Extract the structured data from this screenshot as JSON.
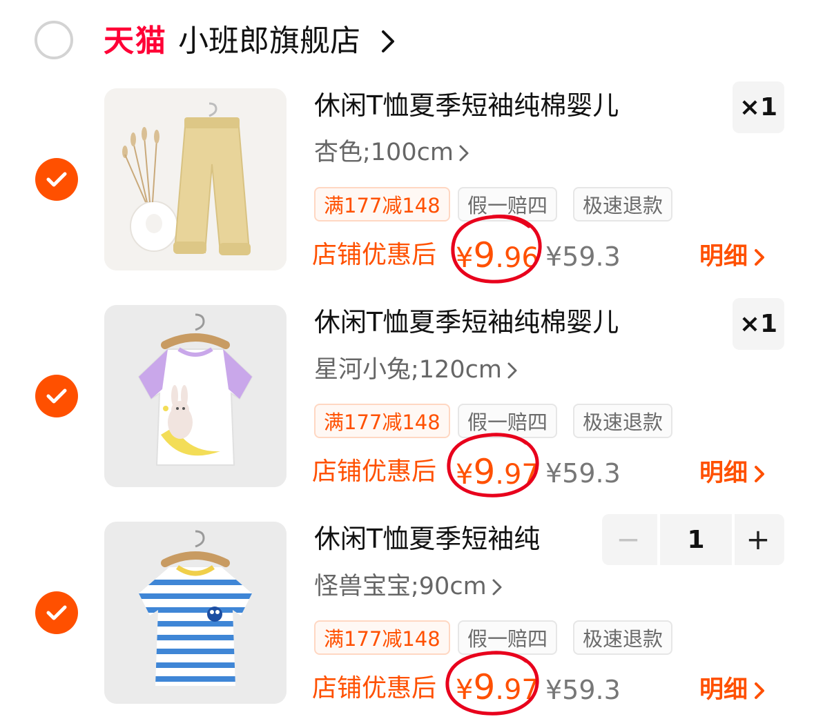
{
  "store": {
    "platform_logo": "天猫",
    "name": "小班郎旗舰店"
  },
  "items": [
    {
      "title": "休闲T恤夏季短袖纯棉婴儿",
      "sku": "杏色;100cm",
      "tags": [
        "满177减148",
        "假一赔四",
        "极速退款"
      ],
      "price_label": "店铺优惠后",
      "price_currency": "¥",
      "price_int": "9",
      "price_dec": ".96",
      "original_price": "¥59.3",
      "detail_label": "明细",
      "quantity": "×1",
      "image": "pants-icon"
    },
    {
      "title": "休闲T恤夏季短袖纯棉婴儿",
      "sku": "星河小兔;120cm",
      "tags": [
        "满177减148",
        "假一赔四",
        "极速退款"
      ],
      "price_label": "店铺优惠后",
      "price_currency": "¥",
      "price_int": "9",
      "price_dec": ".97",
      "original_price": "¥59.3",
      "detail_label": "明细",
      "quantity": "×1",
      "image": "bunny-tshirt-icon"
    },
    {
      "title": "休闲T恤夏季短袖纯",
      "sku": "怪兽宝宝;90cm",
      "tags": [
        "满177减148",
        "假一赔四",
        "极速退款"
      ],
      "price_label": "店铺优惠后",
      "price_currency": "¥",
      "price_int": "9",
      "price_dec": ".97",
      "original_price": "¥59.3",
      "detail_label": "明细",
      "stepper": {
        "minus": "−",
        "value": "1",
        "plus": "+"
      },
      "image": "striped-tshirt-icon"
    }
  ],
  "colors": {
    "accent": "#ff5000",
    "tmall": "#ff0036",
    "annotation": "#e8001c"
  }
}
